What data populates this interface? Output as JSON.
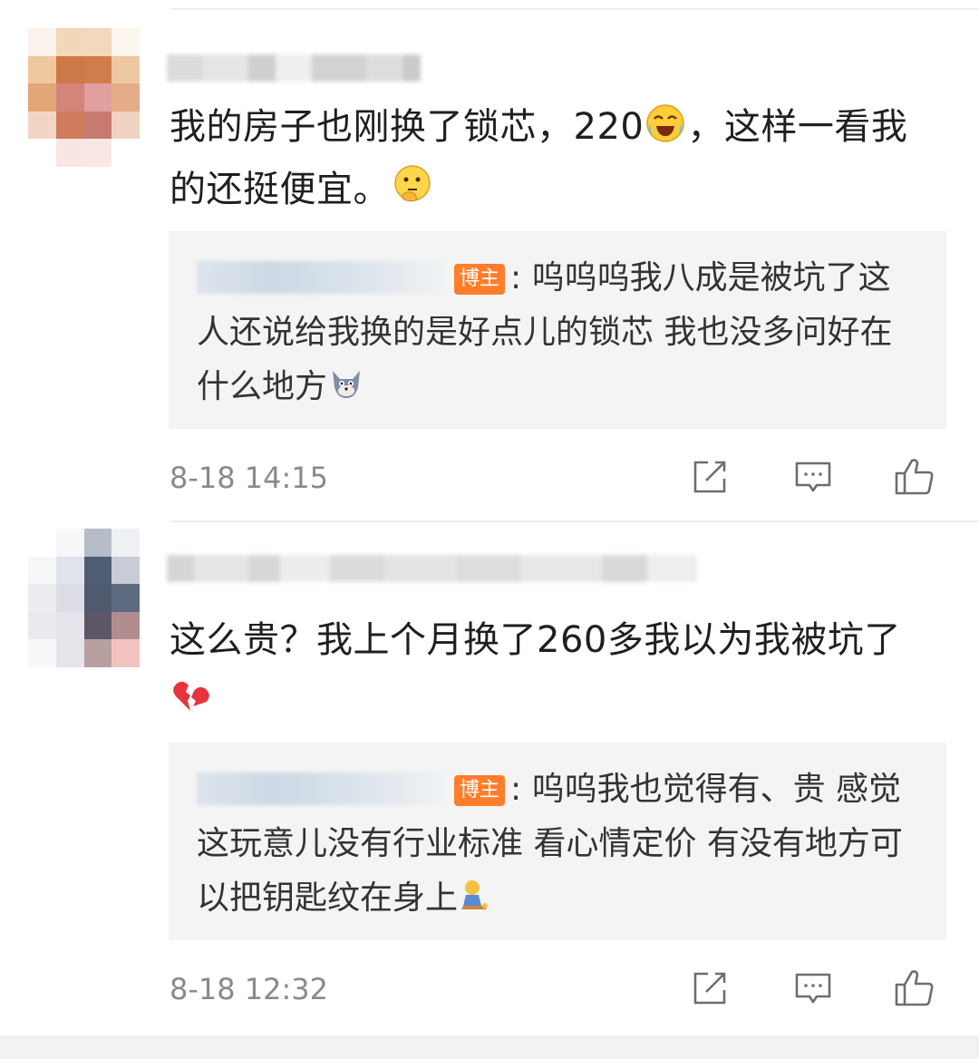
{
  "comments": [
    {
      "text": "我的房子也刚换了锁芯，220",
      "text_after_emoji1": "，这样一看我的还挺便宜。",
      "emoji1": "crying-laughing-emoji",
      "emoji2": "thinking-emoji",
      "reply": {
        "badge": "博主",
        "text": ": 呜呜呜我八成是被坑了这人还说给我换的是好点儿的锁芯  我也没多问好在什么地方",
        "emoji": "tom-cat-emoji"
      },
      "time": "8-18 14:15"
    },
    {
      "text": "这么贵？我上个月换了260多我以为我被坑了",
      "emoji1": "broken-heart-emoji",
      "reply": {
        "badge": "博主",
        "text": ": 呜呜我也觉得有、贵  感觉这玩意儿没有行业标准 看心情定价  有没有地方可以把钥匙纹在身上",
        "emoji": "sitting-figure-emoji"
      },
      "time": "8-18 12:32"
    }
  ],
  "actions": [
    "repost-icon",
    "comment-icon",
    "like-icon"
  ],
  "colors": {
    "badge": "#ff7d2b",
    "reply_bg": "#f4f4f4",
    "meta": "#8a8a8a"
  }
}
